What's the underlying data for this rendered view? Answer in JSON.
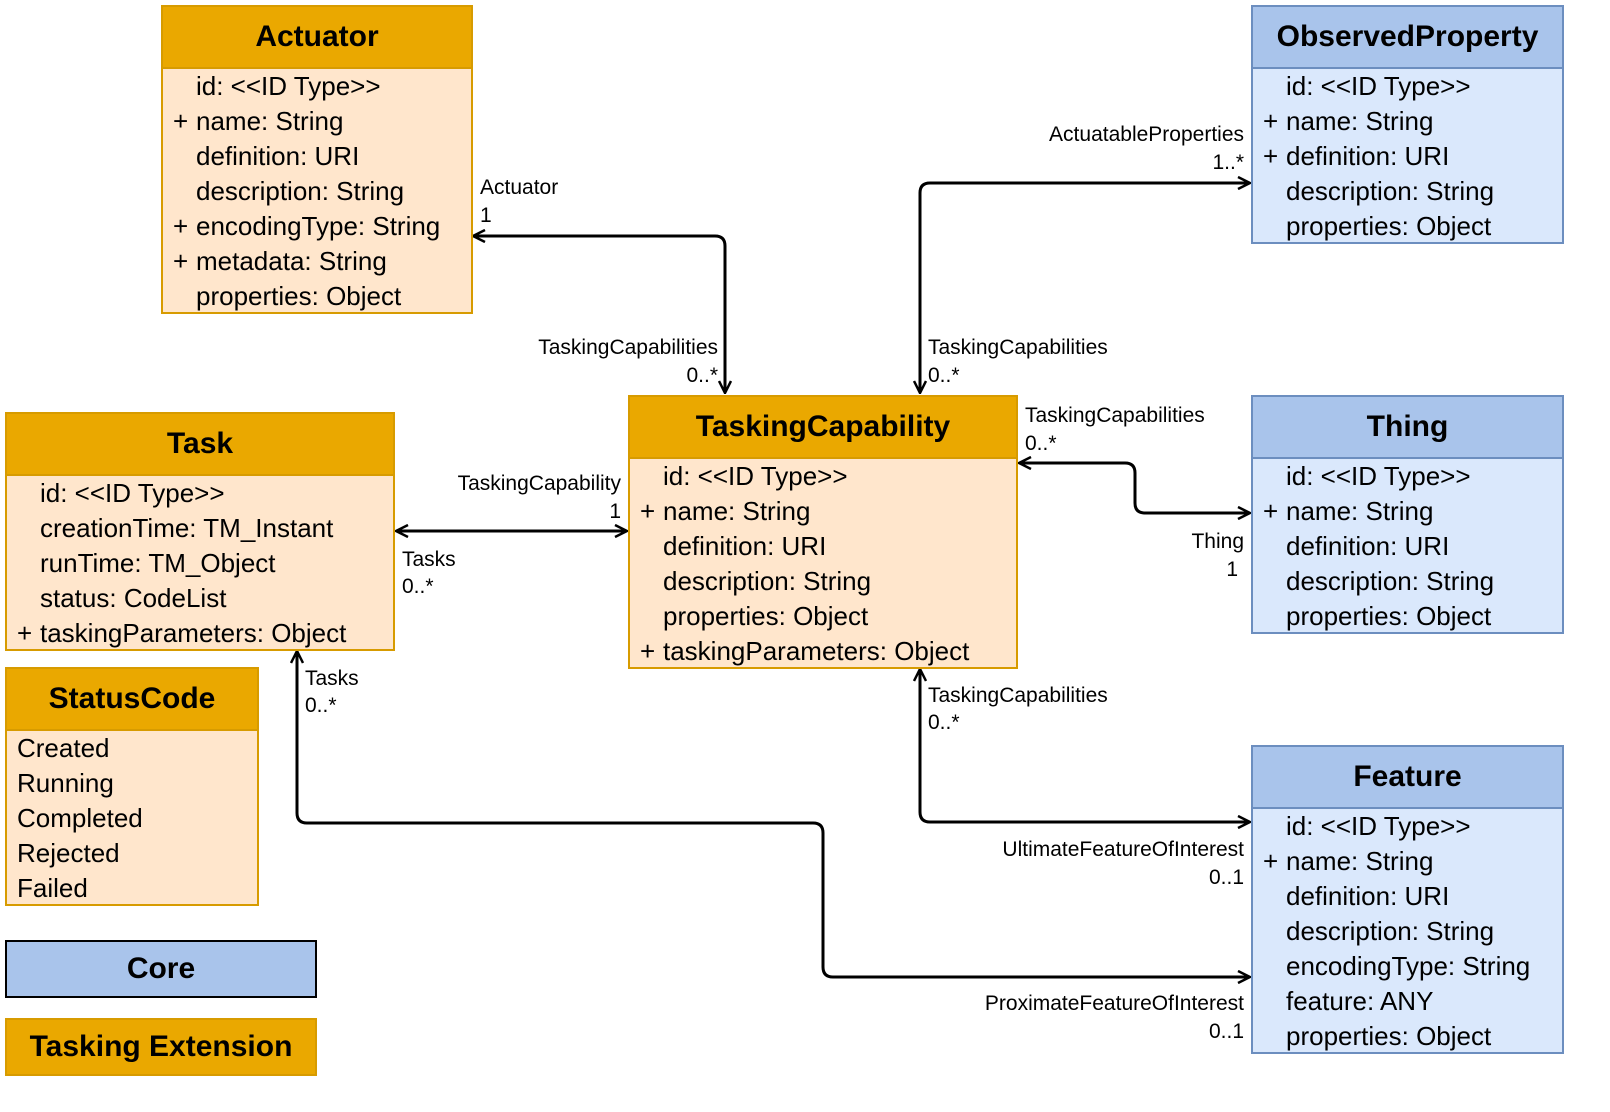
{
  "classes": [
    {
      "name": "Actuator",
      "theme": "tasking",
      "attributes": [
        {
          "vis": "",
          "text": "id: <<ID Type>>"
        },
        {
          "vis": "+",
          "text": "name: String"
        },
        {
          "vis": "",
          "text": "definition: URI"
        },
        {
          "vis": "",
          "text": "description: String"
        },
        {
          "vis": "+",
          "text": "encodingType: String"
        },
        {
          "vis": "+",
          "text": "metadata: String"
        },
        {
          "vis": "",
          "text": "properties: Object"
        }
      ]
    },
    {
      "name": "ObservedProperty",
      "theme": "core",
      "attributes": [
        {
          "vis": "",
          "text": "id: <<ID Type>>"
        },
        {
          "vis": "+",
          "text": "name: String"
        },
        {
          "vis": "+",
          "text": "definition: URI"
        },
        {
          "vis": "",
          "text": "description: String"
        },
        {
          "vis": "",
          "text": "properties: Object"
        }
      ]
    },
    {
      "name": "Task",
      "theme": "tasking",
      "attributes": [
        {
          "vis": "",
          "text": "id: <<ID Type>>"
        },
        {
          "vis": "",
          "text": "creationTime: TM_Instant"
        },
        {
          "vis": "",
          "text": "runTime: TM_Object"
        },
        {
          "vis": "",
          "text": "status: CodeList"
        },
        {
          "vis": "+",
          "text": "taskingParameters: Object"
        }
      ]
    },
    {
      "name": "TaskingCapability",
      "theme": "tasking",
      "attributes": [
        {
          "vis": "",
          "text": "id: <<ID Type>>"
        },
        {
          "vis": "+",
          "text": "name: String"
        },
        {
          "vis": "",
          "text": "definition: URI"
        },
        {
          "vis": "",
          "text": "description: String"
        },
        {
          "vis": "",
          "text": "properties: Object"
        },
        {
          "vis": "+",
          "text": "taskingParameters: Object"
        }
      ]
    },
    {
      "name": "Thing",
      "theme": "core",
      "attributes": [
        {
          "vis": "",
          "text": "id: <<ID Type>>"
        },
        {
          "vis": "+",
          "text": "name: String"
        },
        {
          "vis": "",
          "text": "definition: URI"
        },
        {
          "vis": "",
          "text": "description: String"
        },
        {
          "vis": "",
          "text": "properties: Object"
        }
      ]
    },
    {
      "name": "StatusCode",
      "theme": "tasking",
      "plain": true,
      "attributes": [
        {
          "vis": "",
          "text": "Created"
        },
        {
          "vis": "",
          "text": "Running"
        },
        {
          "vis": "",
          "text": "Completed"
        },
        {
          "vis": "",
          "text": "Rejected"
        },
        {
          "vis": "",
          "text": "Failed"
        }
      ]
    },
    {
      "name": "Feature",
      "theme": "core",
      "attributes": [
        {
          "vis": "",
          "text": "id: <<ID Type>>"
        },
        {
          "vis": "+",
          "text": "name: String"
        },
        {
          "vis": "",
          "text": "definition: URI"
        },
        {
          "vis": "",
          "text": "description: String"
        },
        {
          "vis": "",
          "text": "encodingType: String"
        },
        {
          "vis": "",
          "text": "feature: ANY"
        },
        {
          "vis": "",
          "text": "properties: Object"
        }
      ]
    }
  ],
  "legend": {
    "core": "Core",
    "tasking": "Tasking Extension"
  },
  "associations": [
    {
      "from": "Actuator",
      "to": "TaskingCapability",
      "labels": [
        "Actuator",
        "1",
        "TaskingCapabilities",
        "0..*"
      ]
    },
    {
      "from": "ObservedProperty",
      "to": "TaskingCapability",
      "labels": [
        "ActuatableProperties",
        "1..*",
        "TaskingCapabilities",
        "0..*"
      ]
    },
    {
      "from": "Thing",
      "to": "TaskingCapability",
      "labels": [
        "TaskingCapabilities",
        "0..*",
        "Thing",
        "1"
      ]
    },
    {
      "from": "Task",
      "to": "TaskingCapability",
      "labels": [
        "TaskingCapability",
        "1",
        "Tasks",
        "0..*"
      ]
    },
    {
      "from": "Feature",
      "to": "TaskingCapability",
      "labels": [
        "TaskingCapabilities",
        "0..*",
        "UltimateFeatureOfInterest",
        "0..1"
      ]
    },
    {
      "from": "Feature",
      "to": "Task",
      "labels": [
        "Tasks",
        "0..*",
        "ProximateFeatureOfInterest",
        "0..1"
      ]
    }
  ],
  "colors": {
    "tasking_header": "#eaa800",
    "tasking_body": "#ffe6cc",
    "tasking_border": "#d79b00",
    "core_header": "#a9c4eb",
    "core_body": "#dae8fc",
    "core_border": "#6c8ebf"
  }
}
